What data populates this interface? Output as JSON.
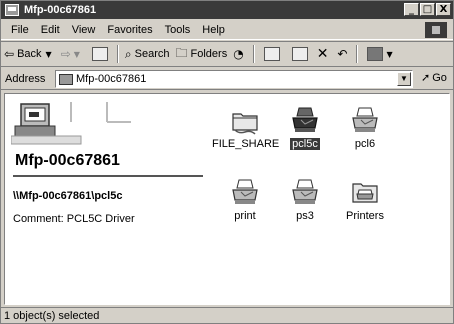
{
  "window": {
    "title": "Mfp-00c67861",
    "controls": [
      "_",
      "□",
      "X"
    ]
  },
  "menu": [
    "File",
    "Edit",
    "View",
    "Favorites",
    "Tools",
    "Help"
  ],
  "toolbar": {
    "back_label": "Back",
    "search_label": "Search",
    "folders_label": "Folders"
  },
  "address": {
    "label": "Address",
    "value": "Mfp-00c67861",
    "go_label": "Go"
  },
  "left_pane": {
    "heading": "Mfp-00c67861",
    "path_prefix": "\\\\Mfp-00c67861\\",
    "path_share": "pcl5c",
    "comment": "Comment: PCL5C Driver"
  },
  "items": [
    {
      "label": "FILE_SHARE",
      "icon": "shared-folder-icon",
      "selected": false
    },
    {
      "label": "pcl5c",
      "icon": "printer-icon",
      "selected": true
    },
    {
      "label": "pcl6",
      "icon": "printer-icon",
      "selected": false
    },
    {
      "label": "print",
      "icon": "printer-icon",
      "selected": false
    },
    {
      "label": "ps3",
      "icon": "printer-icon",
      "selected": false
    },
    {
      "label": "Printers",
      "icon": "printers-folder-icon",
      "selected": false
    }
  ],
  "status": {
    "text": "1 object(s) selected"
  }
}
